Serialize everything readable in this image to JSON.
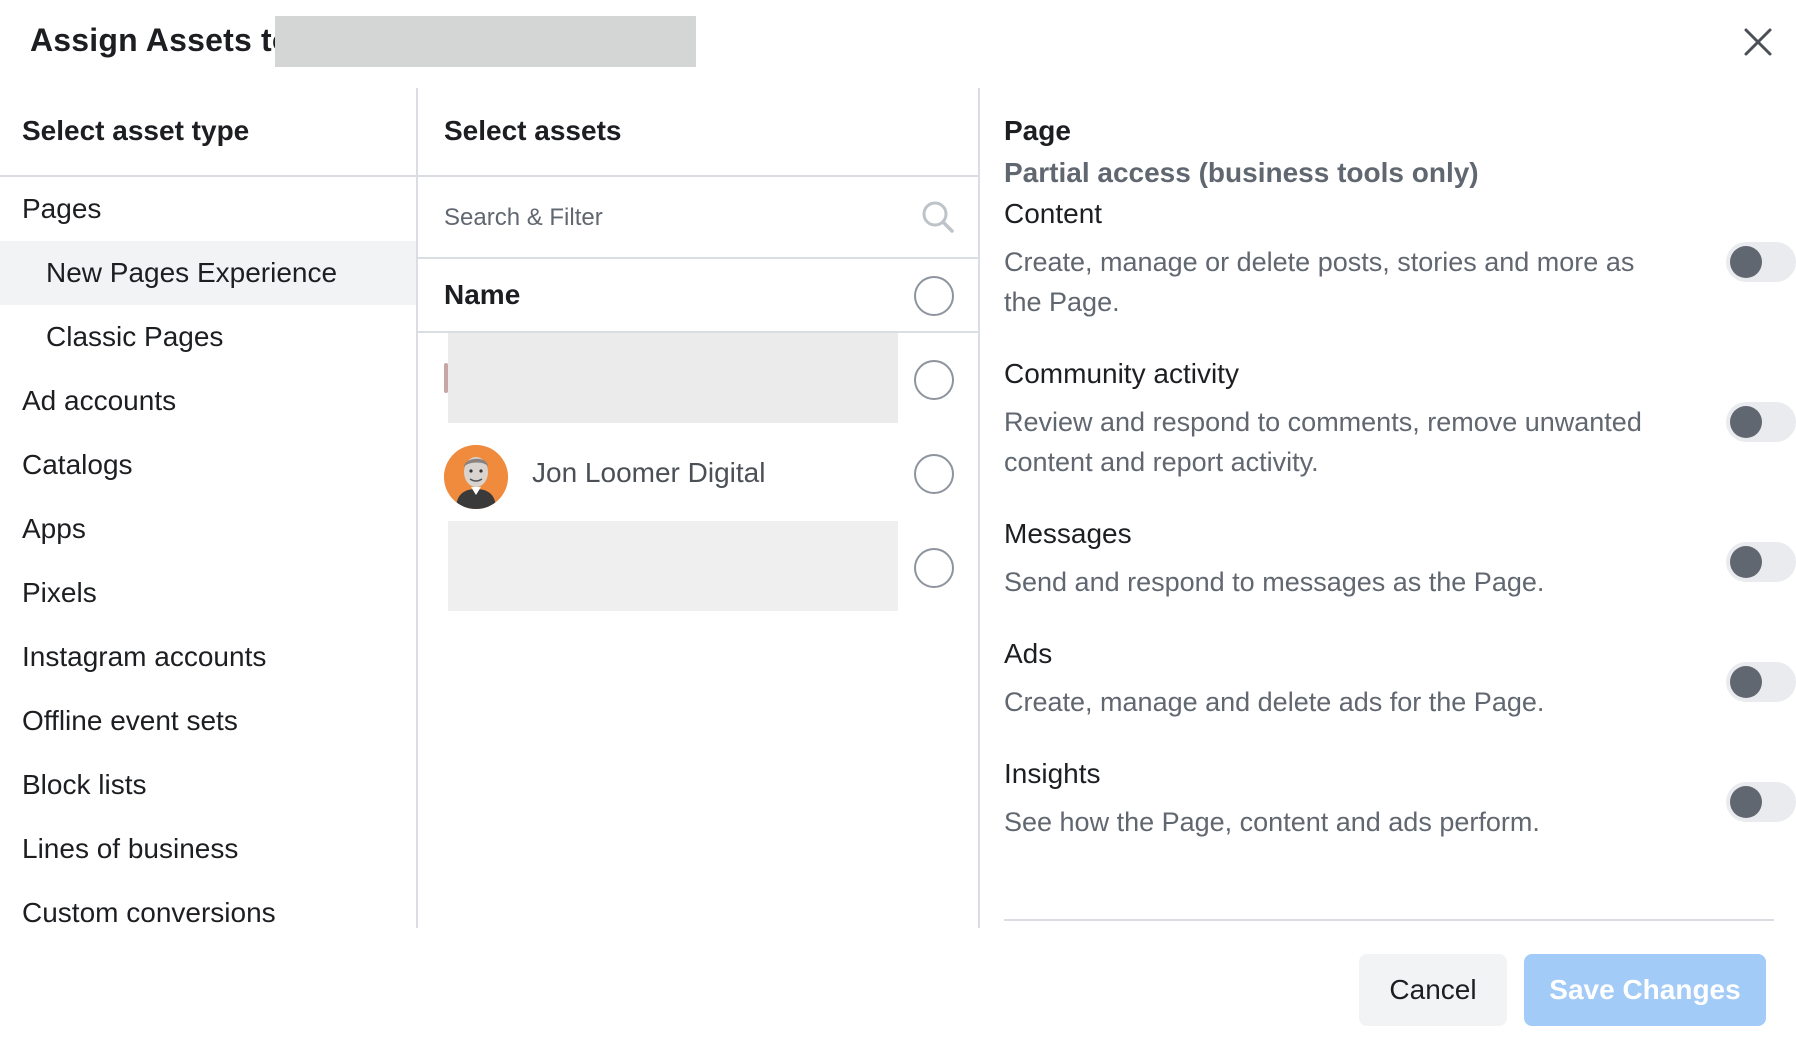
{
  "dialog": {
    "title": "Assign Assets to"
  },
  "left": {
    "header": "Select asset type",
    "items": [
      {
        "label": "Pages",
        "sub": false,
        "active": false
      },
      {
        "label": "New Pages Experience",
        "sub": true,
        "active": true
      },
      {
        "label": "Classic Pages",
        "sub": true,
        "active": false
      },
      {
        "label": "Ad accounts",
        "sub": false,
        "active": false
      },
      {
        "label": "Catalogs",
        "sub": false,
        "active": false
      },
      {
        "label": "Apps",
        "sub": false,
        "active": false
      },
      {
        "label": "Pixels",
        "sub": false,
        "active": false
      },
      {
        "label": "Instagram accounts",
        "sub": false,
        "active": false
      },
      {
        "label": "Offline event sets",
        "sub": false,
        "active": false
      },
      {
        "label": "Block lists",
        "sub": false,
        "active": false
      },
      {
        "label": "Lines of business",
        "sub": false,
        "active": false
      },
      {
        "label": "Custom conversions",
        "sub": false,
        "active": false
      }
    ]
  },
  "middle": {
    "header": "Select assets",
    "search_placeholder": "Search & Filter",
    "name_column": "Name",
    "assets": [
      {
        "name": ""
      },
      {
        "name": "Jon Loomer Digital"
      },
      {
        "name": ""
      }
    ]
  },
  "right": {
    "title": "Page",
    "subtitle": "Partial access (business tools only)",
    "permissions": [
      {
        "name": "Content",
        "description": "Create, manage or delete posts, stories and more as the Page.",
        "enabled": false
      },
      {
        "name": "Community activity",
        "description": "Review and respond to comments, remove unwanted content and report activity.",
        "enabled": false
      },
      {
        "name": "Messages",
        "description": "Send and respond to messages as the Page.",
        "enabled": false
      },
      {
        "name": "Ads",
        "description": "Create, manage and delete ads for the Page.",
        "enabled": false
      },
      {
        "name": "Insights",
        "description": "See how the Page, content and ads perform.",
        "enabled": false
      }
    ]
  },
  "footer": {
    "cancel_label": "Cancel",
    "save_label": "Save Changes"
  },
  "colors": {
    "accent_disabled": "#a3cbf7",
    "toggle_off_track": "#e9ebee",
    "toggle_off_knob": "#606770",
    "avatar_bg": "#f08a3c"
  },
  "icons": {
    "close": "close-icon",
    "search": "search-icon"
  }
}
